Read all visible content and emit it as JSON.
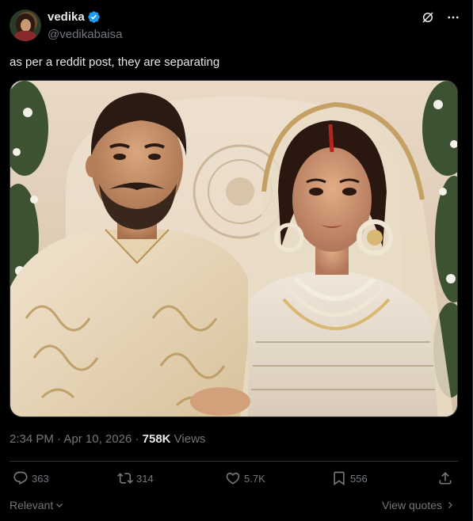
{
  "author": {
    "display_name": "vedika",
    "handle": "@vedikabaisa",
    "verified": true
  },
  "tweet": {
    "text": "as per a reddit post, they are separating",
    "time": "2:34 PM",
    "separator": " · ",
    "date": "Apr 10, 2026",
    "views_count": "758K",
    "views_label": " Views"
  },
  "stats": {
    "replies": "363",
    "retweets": "314",
    "likes": "5.7K",
    "bookmarks": "556"
  },
  "footer": {
    "sort_label": "Relevant",
    "view_quotes_label": "View quotes"
  },
  "colors": {
    "background": "#000000",
    "text": "#e7e9ea",
    "muted": "#71767b",
    "verified": "#1d9bf0",
    "border": "#2f3336"
  },
  "icons": [
    "verified-badge-icon",
    "grok-icon",
    "more-icon",
    "reply-icon",
    "retweet-icon",
    "like-icon",
    "bookmark-icon",
    "share-icon",
    "chevron-down-icon",
    "chevron-right-icon"
  ]
}
